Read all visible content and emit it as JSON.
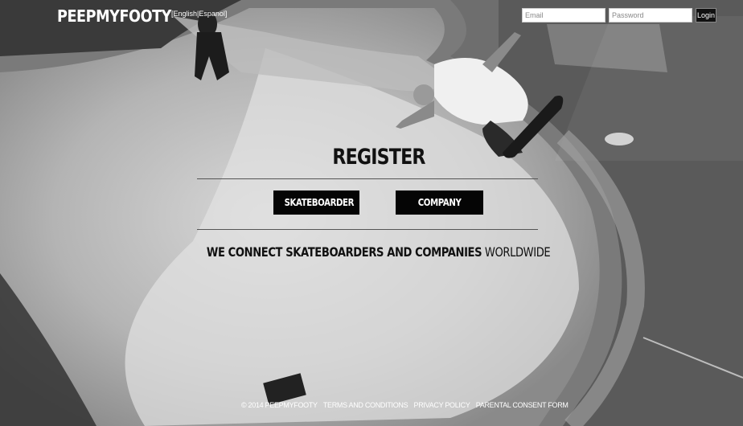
{
  "header": {
    "logo": "PEEPMYFOOTY",
    "lang_open": "[",
    "lang_english": "English",
    "lang_sep": "|",
    "lang_spanish": "Espanol",
    "lang_close": "]",
    "email_placeholder": "Email",
    "password_placeholder": "Password",
    "login_label": "Login"
  },
  "main": {
    "title": "REGISTER",
    "skateboarder_label": "SKATEBOARDER",
    "company_label": "COMPANY",
    "tagline_bold": "WE CONNECT SKATEBOARDERS AND COMPANIES",
    "tagline_rest": "WORLDWIDE"
  },
  "footer": {
    "copyright": "© 2014 PEEPMYFOOTY",
    "terms": "TERMS AND CONDITIONS",
    "privacy": "PRIVACY POLICY",
    "parental": "PARENTAL CONSENT FORM"
  }
}
